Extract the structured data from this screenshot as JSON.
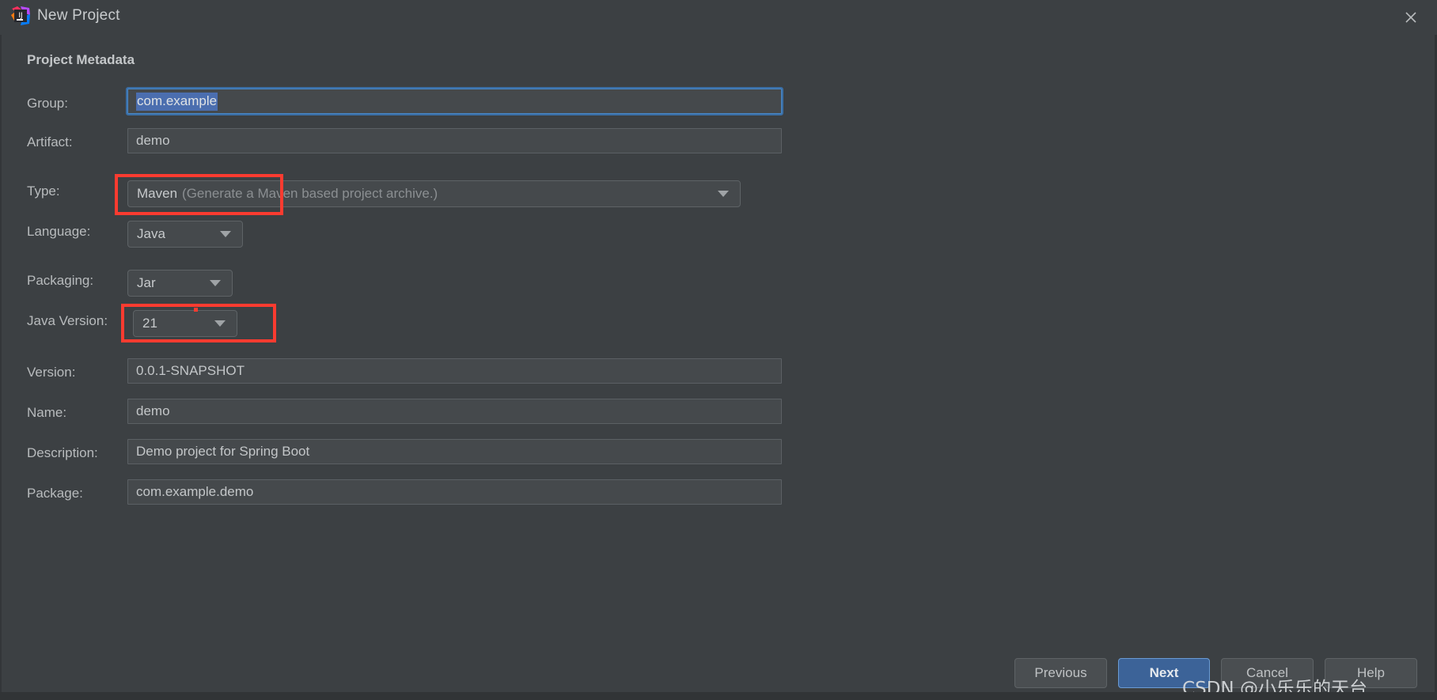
{
  "window": {
    "title": "New Project",
    "logo_icon": "intellij-idea-logo",
    "close_icon": "close-icon"
  },
  "section": {
    "heading": "Project Metadata"
  },
  "fields": {
    "group": {
      "label": "Group:",
      "value": "com.example",
      "selected": true,
      "focused": true
    },
    "artifact": {
      "label": "Artifact:",
      "value": "demo"
    },
    "type": {
      "label": "Type:",
      "value": "Maven",
      "hint": "(Generate a Maven based project archive.)",
      "annotated": true
    },
    "language": {
      "label": "Language:",
      "value": "Java"
    },
    "packaging": {
      "label": "Packaging:",
      "value": "Jar"
    },
    "java_version": {
      "label": "Java Version:",
      "value": "21",
      "annotated": true
    },
    "version": {
      "label": "Version:",
      "value": "0.0.1-SNAPSHOT"
    },
    "name": {
      "label": "Name:",
      "value": "demo"
    },
    "description": {
      "label": "Description:",
      "value": "Demo project for Spring Boot"
    },
    "package": {
      "label": "Package:",
      "value": "com.example.demo"
    }
  },
  "footer": {
    "previous": "Previous",
    "next": "Next",
    "cancel": "Cancel",
    "help": "Help"
  },
  "watermark": {
    "text": "CSDN @小乐乐的天台"
  },
  "colors": {
    "background": "#3c4043",
    "field_background": "#45494c",
    "accent_blue": "#3c6398",
    "selection_blue": "#4b6eaf",
    "annotation_red": "#fb3b30",
    "text": "#bbbbbb"
  }
}
